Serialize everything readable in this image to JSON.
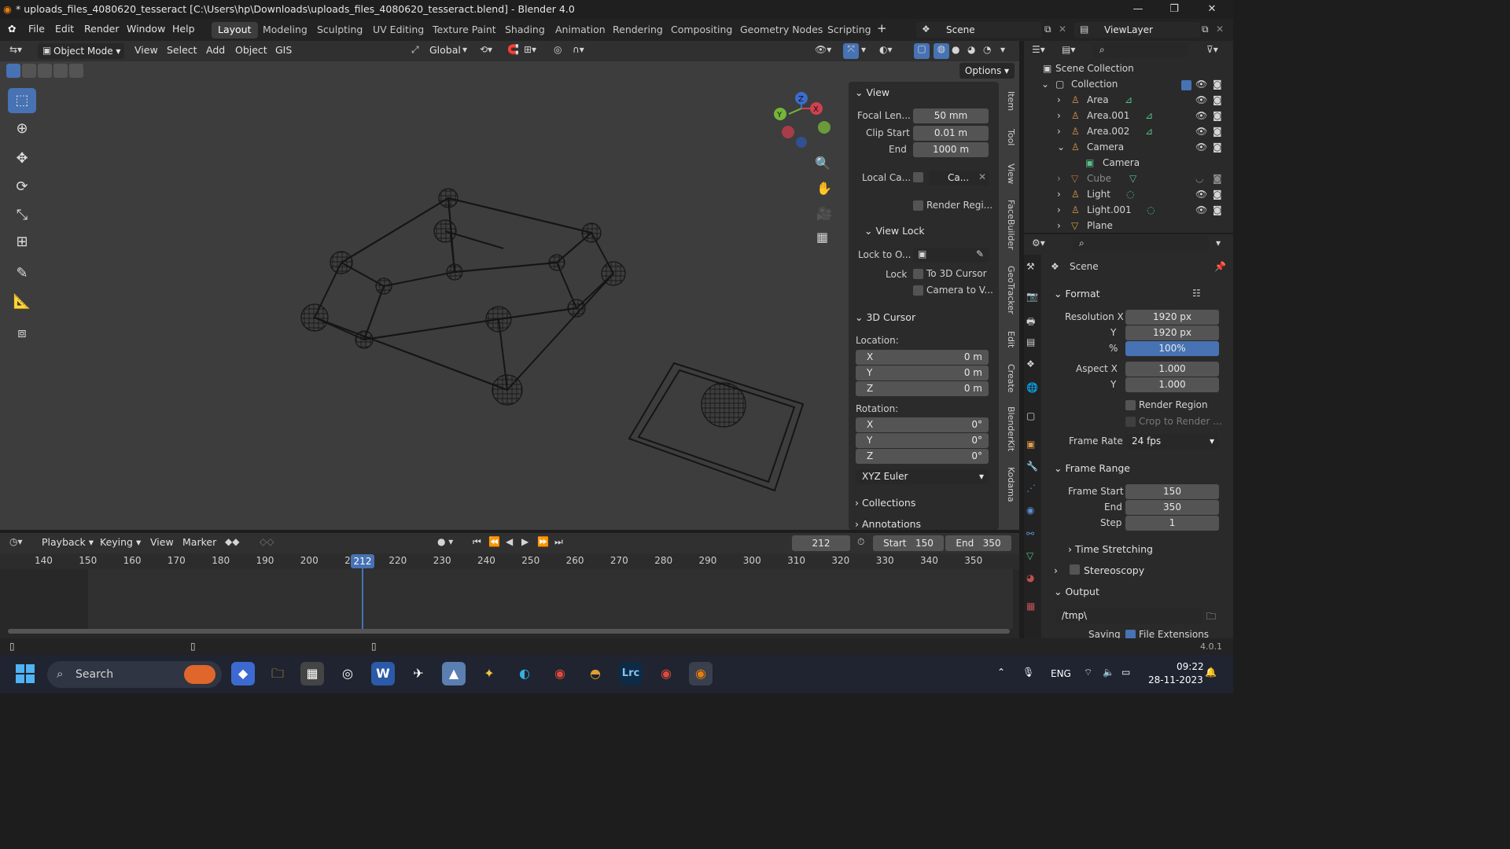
{
  "window": {
    "title": "* uploads_files_4080620_tesseract [C:\\Users\\hp\\Downloads\\uploads_files_4080620_tesseract.blend] - Blender 4.0"
  },
  "menu": {
    "file": "File",
    "edit": "Edit",
    "render": "Render",
    "window": "Window",
    "help": "Help"
  },
  "workspaces": [
    "Layout",
    "Modeling",
    "Sculpting",
    "UV Editing",
    "Texture Paint",
    "Shading",
    "Animation",
    "Rendering",
    "Compositing",
    "Geometry Nodes",
    "Scripting"
  ],
  "scene": {
    "name": "Scene",
    "view_layer": "ViewLayer"
  },
  "viewport_header": {
    "mode": "Object Mode",
    "view": "View",
    "select": "Select",
    "add": "Add",
    "object": "Object",
    "gis": "GIS",
    "transform": "Global",
    "options": "Options"
  },
  "npanel": {
    "view_section": "View",
    "focal_label": "Focal Len...",
    "focal_value": "50 mm",
    "clip_start_label": "Clip Start",
    "clip_start_value": "0.01 m",
    "clip_end_label": "End",
    "clip_end_value": "1000 m",
    "local_camera_label": "Local Ca...",
    "local_camera_value": "Ca...",
    "render_region": "Render Regi...",
    "view_lock_section": "View Lock",
    "lock_obj_label": "Lock to O...",
    "lock_label": "Lock",
    "to_cursor": "To 3D Cursor",
    "camera_to_view": "Camera to V...",
    "cursor_section": "3D Cursor",
    "location_label": "Location:",
    "rotation_label": "Rotation:",
    "loc_x": "0 m",
    "loc_y": "0 m",
    "loc_z": "0 m",
    "rot_x": "0°",
    "rot_y": "0°",
    "rot_z": "0°",
    "x": "X",
    "y": "Y",
    "z": "Z",
    "rotation_mode": "XYZ Euler",
    "collections": "Collections",
    "annotations": "Annotations"
  },
  "side_tabs": [
    "Item",
    "Tool",
    "View",
    "FaceBuilder",
    "GeoTracker",
    "Edit",
    "Create",
    "BlenderKit",
    "Kodama"
  ],
  "outliner": {
    "root": "Scene Collection",
    "collection": "Collection",
    "items": [
      "Area",
      "Area.001",
      "Area.002",
      "Camera",
      "Camera",
      "Cube",
      "Light",
      "Light.001",
      "Plane"
    ]
  },
  "properties": {
    "context": "Scene",
    "format": "Format",
    "res_x_label": "Resolution X",
    "res_x": "1920 px",
    "res_y_label": "Y",
    "res_y": "1920 px",
    "pct_label": "%",
    "pct": "100%",
    "aspect_x_label": "Aspect X",
    "aspect_x": "1.000",
    "aspect_y_label": "Y",
    "aspect_y": "1.000",
    "render_region": "Render Region",
    "crop": "Crop to Render ...",
    "fps_label": "Frame Rate",
    "fps": "24 fps",
    "frame_range": "Frame Range",
    "start_label": "Frame Start",
    "start": "150",
    "end_label": "End",
    "end": "350",
    "step_label": "Step",
    "step": "1",
    "time_stretching": "Time Stretching",
    "stereoscopy": "Stereoscopy",
    "output": "Output",
    "path": "/tmp\\",
    "saving": "Saving",
    "file_ext": "File Extensions"
  },
  "timeline": {
    "playback": "Playback",
    "keying": "Keying",
    "view": "View",
    "marker": "Marker",
    "current": "212",
    "start_label": "Start",
    "start": "150",
    "end_label": "End",
    "end": "350",
    "ticks": [
      "140",
      "150",
      "160",
      "170",
      "180",
      "190",
      "200",
      "2",
      "220",
      "230",
      "240",
      "250",
      "260",
      "270",
      "280",
      "290",
      "300",
      "310",
      "320",
      "330",
      "340",
      "350"
    ]
  },
  "status": {
    "version": "4.0.1"
  },
  "taskbar": {
    "search": "Search",
    "lang": "ENG",
    "time": "09:22",
    "date": "28-11-2023",
    "lrc": "Lrc"
  },
  "colors": {
    "accent": "#4772b3",
    "bg": "#3d3d3d"
  }
}
